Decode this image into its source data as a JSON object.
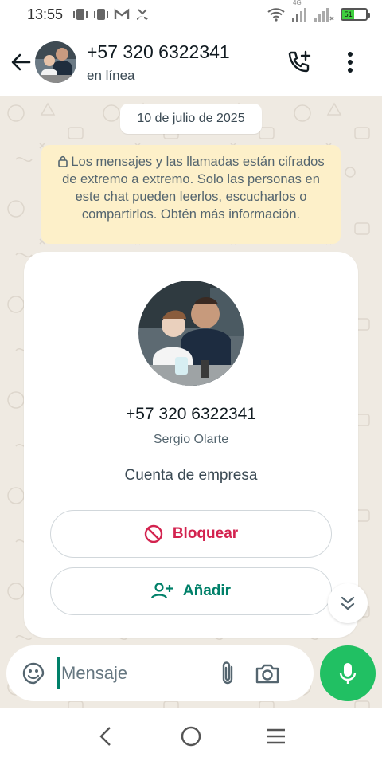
{
  "status_bar": {
    "time": "13:55",
    "network_label": "4G",
    "battery_level": "51",
    "battery_fraction": 0.51
  },
  "header": {
    "contact_name": "+57 320 6322341",
    "contact_status": "en línea",
    "icons": [
      "back-arrow-icon",
      "add-call-icon",
      "more-vertical-icon"
    ]
  },
  "chat": {
    "date_label": "10 de julio de 2025",
    "encryption_notice": "Los mensajes y las llamadas están cifrados de extremo a extremo. Solo las personas en este chat pueden leerlos, escucharlos o compartirlos. Obtén más información.",
    "contact_card": {
      "phone": "+57 320 6322341",
      "name": "Sergio Olarte",
      "account_type": "Cuenta de empresa",
      "block_label": "Bloquear",
      "add_label": "Añadir"
    }
  },
  "input_bar": {
    "placeholder": "Mensaje",
    "icons": [
      "sticker-icon",
      "paperclip-icon",
      "camera-icon",
      "microphone-icon"
    ]
  },
  "nav_bar": {
    "icons": [
      "back-nav-icon",
      "home-nav-icon",
      "recents-nav-icon"
    ]
  },
  "colors": {
    "accent_green": "#008069",
    "mic_green": "#21c063",
    "block_red": "#d3234f",
    "notice_bg": "#fdf0c9",
    "chat_bg": "#efeae2"
  }
}
